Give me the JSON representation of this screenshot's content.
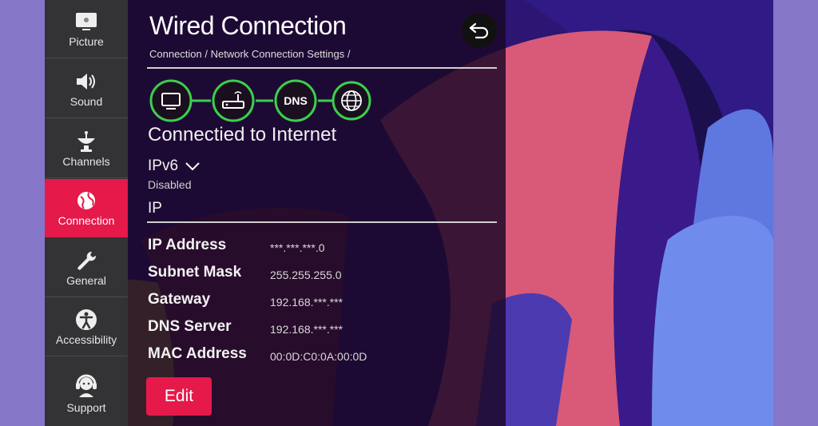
{
  "sidebar": {
    "items": [
      {
        "label": "Picture",
        "icon": "picture-icon"
      },
      {
        "label": "Sound",
        "icon": "speaker-icon"
      },
      {
        "label": "Channels",
        "icon": "satellite-dish-icon"
      },
      {
        "label": "Connection",
        "icon": "globe-icon",
        "active": true
      },
      {
        "label": "General",
        "icon": "wrench-icon"
      },
      {
        "label": "Accessibility",
        "icon": "accessibility-icon"
      },
      {
        "label": "Support",
        "icon": "headset-icon"
      }
    ]
  },
  "panel": {
    "title": "Wired Connection",
    "breadcrumb": "Connection / Network Connection Settings /",
    "status_chain": {
      "nodes": [
        "tv-icon",
        "router-icon",
        "dns-icon",
        "globe-icon"
      ],
      "dns_label": "DNS",
      "color": "#3ccf4e"
    },
    "connection_status": "Connectied to Internet",
    "ipv6": {
      "label": "IPv6",
      "status": "Disabled"
    },
    "ip_section": "IP",
    "details": [
      {
        "label": "IP Address",
        "value": "***.***.***.0"
      },
      {
        "label": "Subnet Mask",
        "value": "255.255.255.0"
      },
      {
        "label": "Gateway",
        "value": "192.168.***.***"
      },
      {
        "label": "DNS Server",
        "value": "192.168.***.***"
      },
      {
        "label": "MAC Address",
        "value": "00:0D:C0:0A:00:0D"
      }
    ],
    "edit_label": "Edit"
  },
  "colors": {
    "accent": "#e5194a",
    "sidebar_bg": "#333336",
    "frame_bg": "#8676c8"
  }
}
